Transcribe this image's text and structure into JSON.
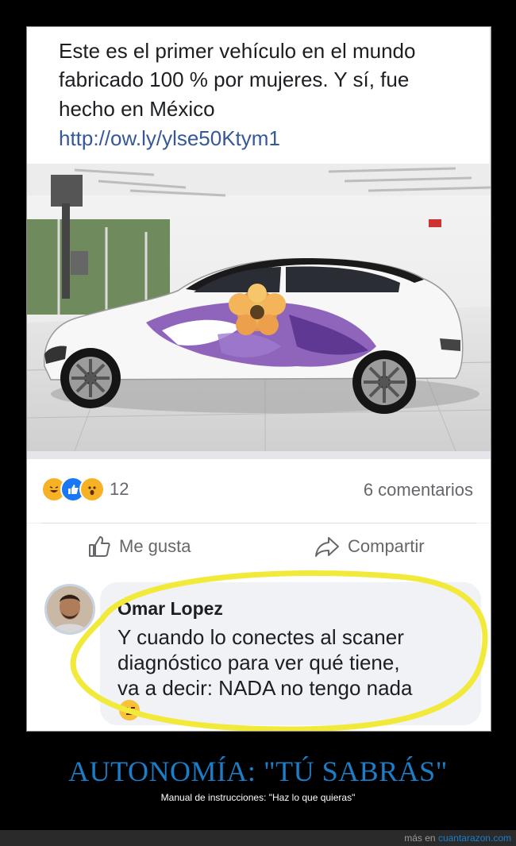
{
  "post": {
    "line1": "Este es el primer vehículo en el mundo",
    "line2": "fabricado 100 % por mujeres. Y sí, fue",
    "line3": "hecho en México",
    "link": "http://ow.ly/ylse50Ktym1"
  },
  "reactions": {
    "icons": [
      "haha-icon",
      "like-icon",
      "wow-icon"
    ],
    "count": "12",
    "comments": "6 comentarios"
  },
  "actions": {
    "like_label": "Me gusta",
    "share_label": "Compartir"
  },
  "comment": {
    "author": "Omar Lopez",
    "line1": "Y cuando lo conectes al scaner",
    "line2": "diagnóstico para ver qué tiene,",
    "line3": "va a decir: NADA no tengo nada"
  },
  "caption": {
    "title": "AUTONOMÍA: \"TÚ SABRÁS\"",
    "subtitle": "Manual de instrucciones: \"Haz lo que quieras\""
  },
  "footer": {
    "prefix": "más en",
    "site": "cuantarazon.com"
  },
  "colors": {
    "link": "#365899",
    "accent": "#1a7ec8",
    "highlight": "#f2ea3a"
  }
}
